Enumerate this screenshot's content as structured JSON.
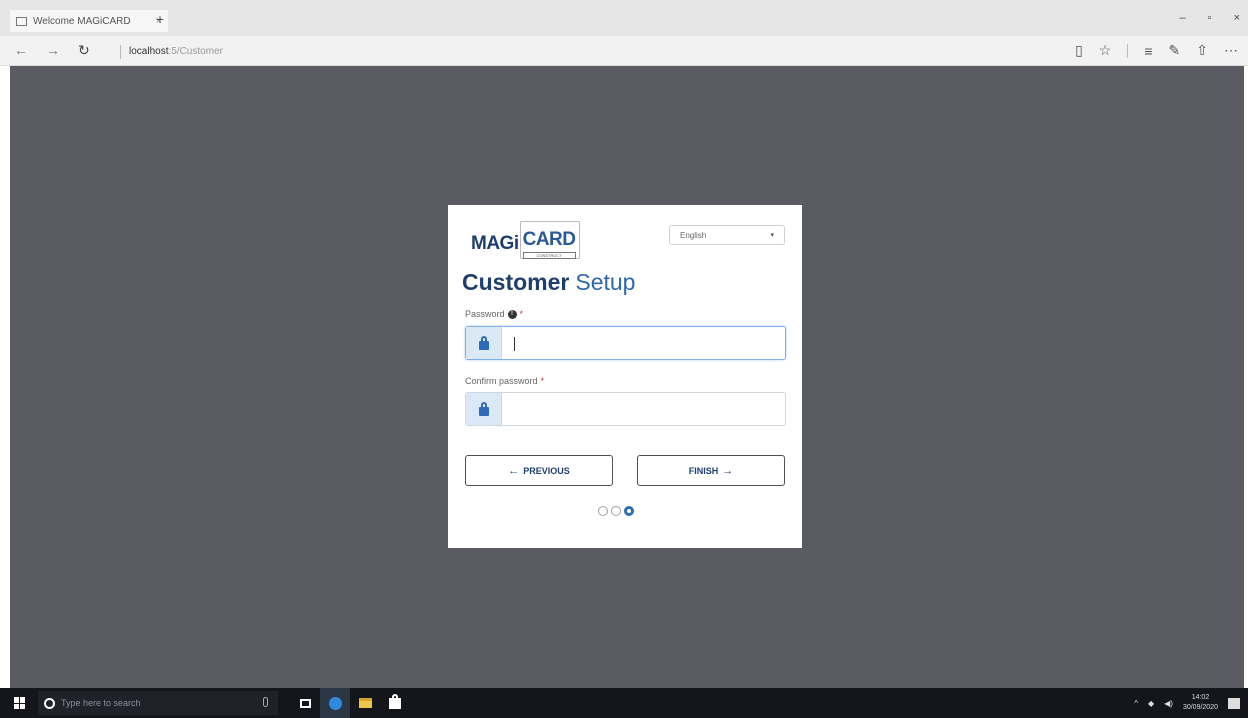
{
  "browser": {
    "tab_title": "Welcome MAGiCARD",
    "tab_close": "×",
    "new_tab": "+",
    "window_controls": [
      "–",
      "▫",
      "×"
    ],
    "nav": {
      "back": "←",
      "forward": "→",
      "refresh": "↻"
    },
    "url_host": "localhost",
    "url_path": ":5/Customer",
    "toolbar_icons": [
      "reading-view-icon",
      "star-icon",
      "hub-icon",
      "notes-icon",
      "share-icon",
      "more-icon"
    ],
    "toolbar_glyphs": {
      "reading": "▯",
      "star": "☆",
      "hub": "≡",
      "notes": "✎",
      "share": "⇧",
      "more": "⋯"
    }
  },
  "card": {
    "logo": {
      "part1": "MAGi",
      "part2": "CARD",
      "tagline": "CONSTRUCT"
    },
    "language": {
      "selected": "English",
      "caret": "▾"
    },
    "heading": {
      "strong": "Customer",
      "light": "Setup"
    },
    "password": {
      "label": "Password",
      "info": "!",
      "required": "*",
      "value": "",
      "placeholder": ""
    },
    "confirm_password": {
      "label": "Confirm password",
      "required": "*",
      "value": "",
      "placeholder": ""
    },
    "buttons": {
      "previous": {
        "arrow": "←",
        "label": "PREVIOUS"
      },
      "finish": {
        "label": "FINISH",
        "arrow": "→"
      }
    },
    "steps": {
      "total": 3,
      "current": 3
    }
  },
  "taskbar": {
    "search_placeholder": "Type here to search",
    "tray_arrow": "^",
    "clock_time": "14:02",
    "clock_date": "30/09/2020"
  },
  "colors": {
    "page_bg": "#5b5c63",
    "brand_dark": "#1e3f6e",
    "brand_blue": "#2c6bb7",
    "addon_bg": "#dbe8f5",
    "required": "#d23434"
  }
}
